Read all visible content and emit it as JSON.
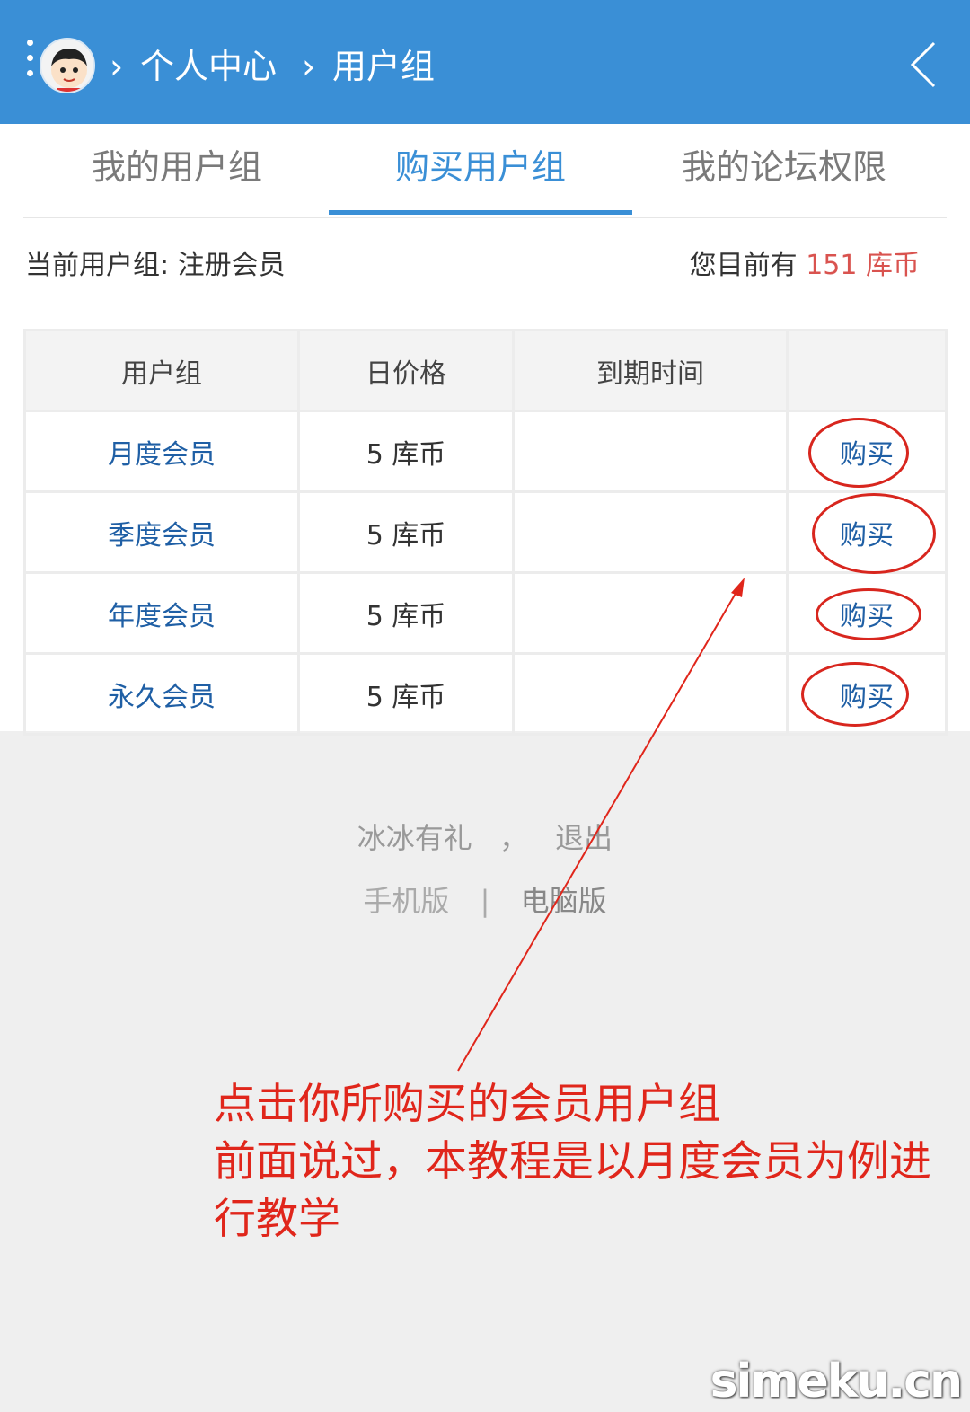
{
  "header": {
    "crumbs": [
      "个人中心",
      "用户组"
    ],
    "separator": "›"
  },
  "tabs": [
    "我的用户组",
    "购买用户组",
    "我的论坛权限"
  ],
  "active_tab": 1,
  "info": {
    "current_group_label": "当前用户组: 注册会员",
    "balance_prefix": "您目前有",
    "balance_value": "151 库币"
  },
  "table": {
    "headers": [
      "用户组",
      "日价格",
      "到期时间",
      ""
    ],
    "rows": [
      {
        "group": "月度会员",
        "price": "5 库币",
        "expiry": "",
        "action": "购买"
      },
      {
        "group": "季度会员",
        "price": "5 库币",
        "expiry": "",
        "action": "购买"
      },
      {
        "group": "年度会员",
        "price": "5 库币",
        "expiry": "",
        "action": "购买"
      },
      {
        "group": "永久会员",
        "price": "5 库币",
        "expiry": "",
        "action": "购买"
      }
    ]
  },
  "footer": {
    "user": "冰冰有礼",
    "comma": "，",
    "logout": "退出",
    "mobile": "手机版",
    "divider": "|",
    "desktop": "电脑版"
  },
  "annotation": {
    "line1": "点击你所购买的会员用户组",
    "line2": "前面说过，本教程是以月度会员为例进行教学"
  },
  "watermark": "simeku.cn",
  "colors": {
    "header_bg": "#3a8fd6",
    "accent": "#3a8fd6",
    "coins": "#d9534f",
    "annotation": "#e0261b",
    "link": "#1f5fa5"
  },
  "icons": [
    "menu-dots-icon",
    "avatar",
    "back-chevron-icon",
    "annotation-arrow"
  ]
}
